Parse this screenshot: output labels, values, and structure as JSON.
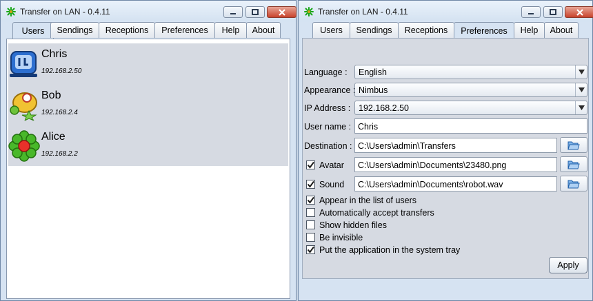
{
  "window_title": "Transfer on LAN - 0.4.11",
  "tabs": [
    "Users",
    "Sendings",
    "Receptions",
    "Preferences",
    "Help",
    "About"
  ],
  "users": [
    {
      "name": "Chris",
      "ip": "192.168.2.50"
    },
    {
      "name": "Bob",
      "ip": "192.168.2.4"
    },
    {
      "name": "Alice",
      "ip": "192.168.2.2"
    }
  ],
  "preferences": {
    "language_label": "Language :",
    "language_value": "English",
    "appearance_label": "Appearance :",
    "appearance_value": "Nimbus",
    "ip_label": "IP Address :",
    "ip_value": "192.168.2.50",
    "username_label": "User name :",
    "username_value": "Chris",
    "destination_label": "Destination :",
    "destination_value": "C:\\Users\\admin\\Transfers",
    "avatar_label": "Avatar",
    "avatar_value": "C:\\Users\\admin\\Documents\\23480.png",
    "sound_label": "Sound",
    "sound_value": "C:\\Users\\admin\\Documents\\robot.wav",
    "options": [
      {
        "label": "Appear in the list of users",
        "checked": true
      },
      {
        "label": "Automatically accept transfers",
        "checked": false
      },
      {
        "label": "Show hidden files",
        "checked": false
      },
      {
        "label": "Be invisible",
        "checked": false
      },
      {
        "label": "Put the application in the system tray",
        "checked": true
      }
    ],
    "avatar_checked": true,
    "sound_checked": true,
    "apply_label": "Apply"
  },
  "colors": {
    "window_bg": "#d6e3f2",
    "close_button": "#c8432c",
    "app_icon": "#19a619"
  }
}
